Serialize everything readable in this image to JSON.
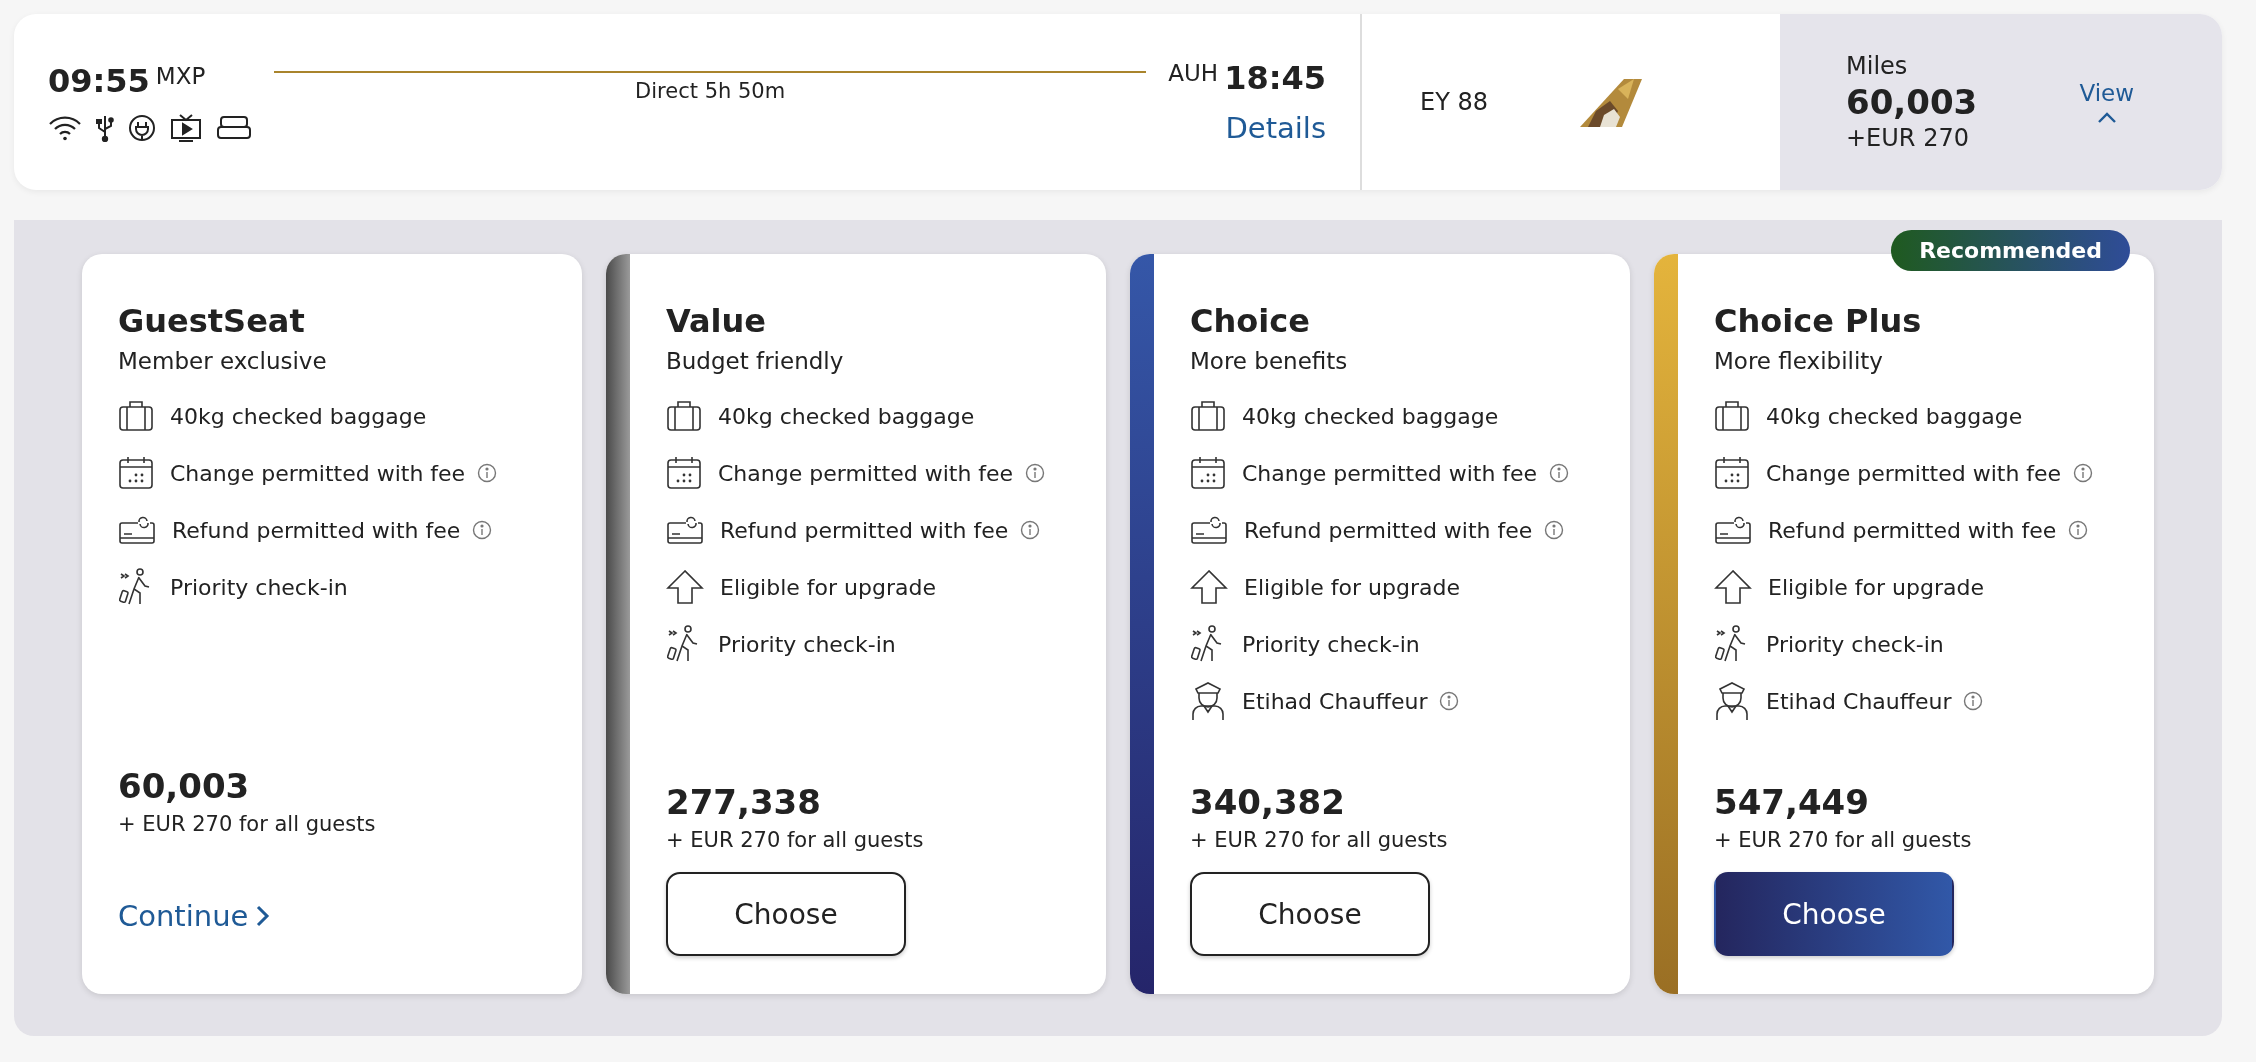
{
  "flight": {
    "departure_time": "09:55",
    "departure_airport": "MXP",
    "duration": "Direct 5h 50m",
    "arrival_airport": "AUH",
    "arrival_time": "18:45",
    "details_link": "Details",
    "flight_number": "EY 88"
  },
  "miles_panel": {
    "label": "Miles",
    "value": "60,003",
    "extra": "+EUR 270",
    "view_link": "View",
    "expanded": true
  },
  "fares": [
    {
      "kind": "member",
      "name": "GuestSeat",
      "subtitle": "Member exclusive",
      "features": [
        {
          "kind": "baggage",
          "text": "40kg checked baggage",
          "info": false
        },
        {
          "kind": "calendar",
          "text": "Change permitted with fee",
          "info": true
        },
        {
          "kind": "refund",
          "text": "Refund permitted with fee",
          "info": true
        },
        {
          "kind": "checkin",
          "text": "Priority check-in",
          "info": false
        }
      ],
      "price": "60,003",
      "price_note": "+ EUR 270 for all guests",
      "action": {
        "kind": "link",
        "label": "Continue"
      }
    },
    {
      "kind": "value",
      "name": "Value",
      "subtitle": "Budget friendly",
      "features": [
        {
          "kind": "baggage",
          "text": "40kg checked baggage",
          "info": false
        },
        {
          "kind": "calendar",
          "text": "Change permitted with fee",
          "info": true
        },
        {
          "kind": "refund",
          "text": "Refund permitted with fee",
          "info": true
        },
        {
          "kind": "upgrade",
          "text": "Eligible for upgrade",
          "info": false
        },
        {
          "kind": "checkin",
          "text": "Priority check-in",
          "info": false
        }
      ],
      "price": "277,338",
      "price_note": "+ EUR 270 for all guests",
      "action": {
        "kind": "outline",
        "label": "Choose"
      }
    },
    {
      "kind": "choice",
      "name": "Choice",
      "subtitle": "More benefits",
      "features": [
        {
          "kind": "baggage",
          "text": "40kg checked baggage",
          "info": false
        },
        {
          "kind": "calendar",
          "text": "Change permitted with fee",
          "info": true
        },
        {
          "kind": "refund",
          "text": "Refund permitted with fee",
          "info": true
        },
        {
          "kind": "upgrade",
          "text": "Eligible for upgrade",
          "info": false
        },
        {
          "kind": "checkin",
          "text": "Priority check-in",
          "info": false
        },
        {
          "kind": "chauffeur",
          "text": "Etihad Chauffeur",
          "info": true
        }
      ],
      "price": "340,382",
      "price_note": "+ EUR 270 for all guests",
      "action": {
        "kind": "outline",
        "label": "Choose"
      }
    },
    {
      "kind": "plus",
      "name": "Choice Plus",
      "subtitle": "More flexibility",
      "badge": "Recommended",
      "features": [
        {
          "kind": "baggage",
          "text": "40kg checked baggage",
          "info": false
        },
        {
          "kind": "calendar",
          "text": "Change permitted with fee",
          "info": true
        },
        {
          "kind": "refund",
          "text": "Refund permitted with fee",
          "info": true
        },
        {
          "kind": "upgrade",
          "text": "Eligible for upgrade",
          "info": false
        },
        {
          "kind": "checkin",
          "text": "Priority check-in",
          "info": false
        },
        {
          "kind": "chauffeur",
          "text": "Etihad Chauffeur",
          "info": true
        }
      ],
      "price": "547,449",
      "price_note": "+ EUR 270 for all guests",
      "action": {
        "kind": "filled",
        "label": "Choose"
      }
    }
  ]
}
